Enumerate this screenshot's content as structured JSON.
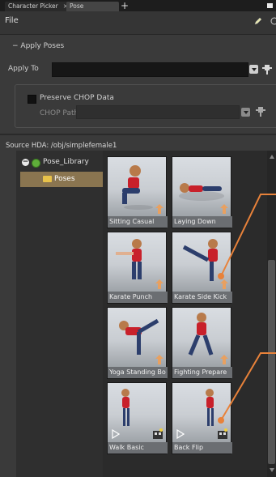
{
  "tabs": [
    {
      "label": "Character Picker"
    },
    {
      "label": "Pose Library"
    }
  ],
  "menu": {
    "file_label": "File"
  },
  "apply_poses": {
    "section_label": "Apply Poses",
    "apply_to_label": "Apply To",
    "apply_to_value": "",
    "preserve_label": "Preserve CHOP Data",
    "preserve_checked": false,
    "chop_path_label": "CHOP Path",
    "chop_path_value": ""
  },
  "source": {
    "label": "Source HDA: /obj/simplefemale1"
  },
  "tree": {
    "root": "Pose_Library",
    "child": "Poses"
  },
  "poses": [
    {
      "name": "Sitting Casual",
      "badge": "arrow-icon"
    },
    {
      "name": "Laying Down",
      "badge": "arrow-icon"
    },
    {
      "name": "Karate Punch",
      "badge": "arrow-icon"
    },
    {
      "name": "Karate Side Kick",
      "badge": "arrow-icon"
    },
    {
      "name": "Yoga Standing Bo",
      "badge": "arrow-icon"
    },
    {
      "name": "Fighting Prepare",
      "badge": "arrow-icon"
    },
    {
      "name": "Walk Basic",
      "badge": "film-icon"
    },
    {
      "name": "Back Flip",
      "badge": "film-icon"
    }
  ],
  "colors": {
    "accent": "#e8823a",
    "selection": "#8a7550",
    "tile_caption": "#6b6e72"
  }
}
